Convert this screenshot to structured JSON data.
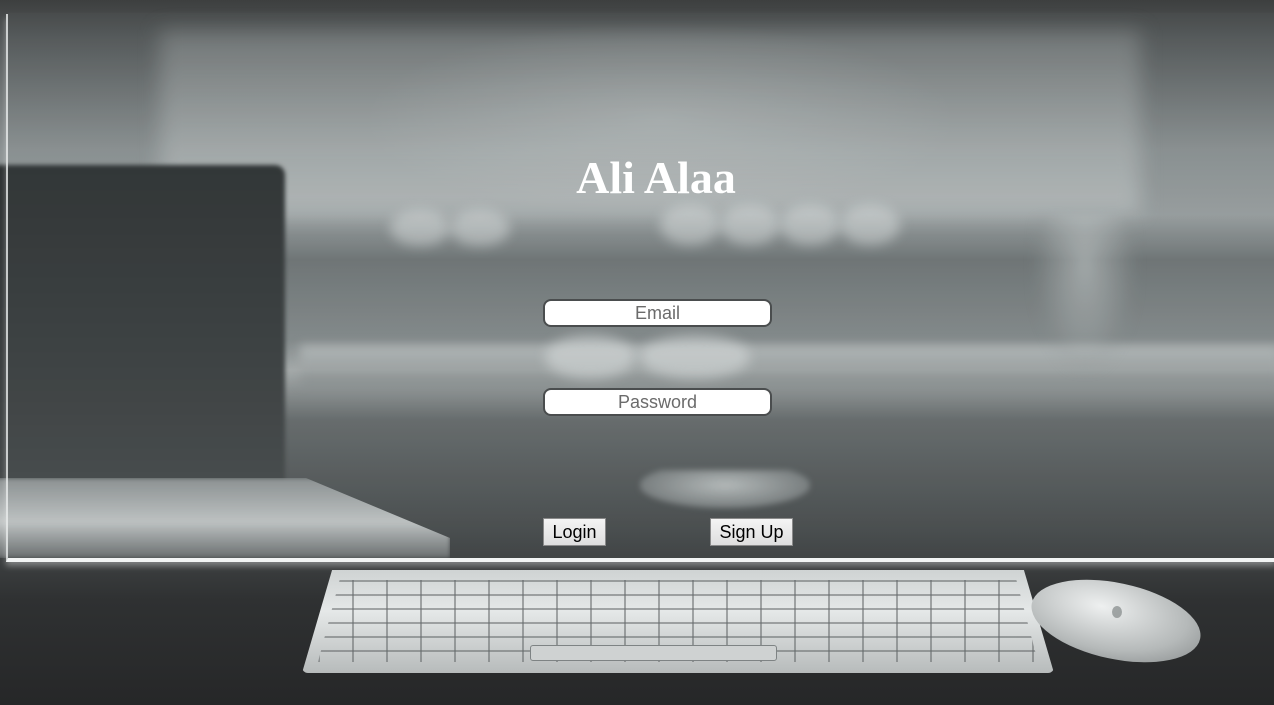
{
  "page": {
    "title": "Ali Alaa"
  },
  "login_form": {
    "email_placeholder": "Email",
    "password_placeholder": "Password",
    "login_label": "Login",
    "signup_label": "Sign Up"
  },
  "colors": {
    "title_text": "#ffffff",
    "panel_border": "#f2f4f4",
    "field_border": "#4a4d4e",
    "button_background": "#e8e8e8"
  },
  "background": {
    "description_icon": "desk-photo-background"
  }
}
